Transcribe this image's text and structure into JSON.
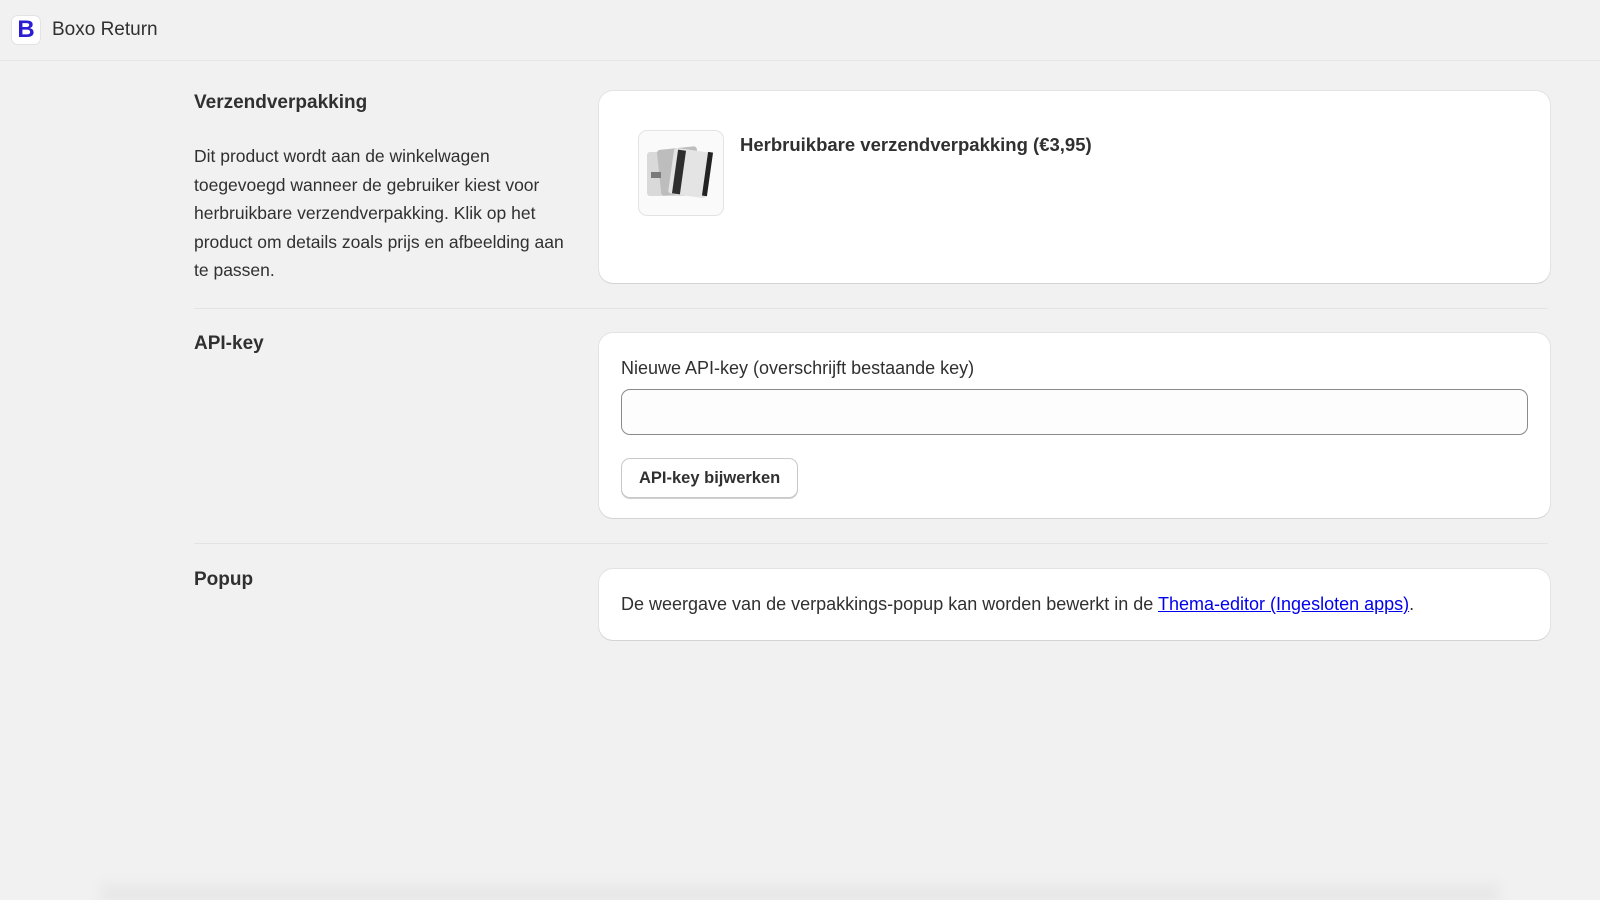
{
  "app": {
    "logo_letter": "B",
    "title": "Boxo Return",
    "brand_color": "#2b1ed1"
  },
  "sections": {
    "packaging": {
      "heading": "Verzendverpakking",
      "description": "Dit product wordt aan de winkelwagen toegevoegd wanneer de gebruiker kiest voor herbruikbare verzendverpakking. Klik op het product om details zoals prijs en afbeelding aan te passen.",
      "product": {
        "title": "Herbruikbare verzendverpakking (€3,95)",
        "thumbnail_icon": "packaging-bags-image"
      }
    },
    "api_key": {
      "heading": "API-key",
      "field_label": "Nieuwe API-key (overschrijft bestaande key)",
      "field_value": "",
      "field_placeholder": "",
      "button_label": "API-key bijwerken"
    },
    "popup": {
      "heading": "Popup",
      "text_before": "De weergave van de verpakkings-popup kan worden bewerkt in de ",
      "link_text": "Thema-editor (Ingesloten apps)",
      "text_after": "."
    }
  },
  "colors": {
    "background": "#f1f1f1",
    "card": "#ffffff",
    "link": "#0000ee",
    "text": "#303030"
  }
}
